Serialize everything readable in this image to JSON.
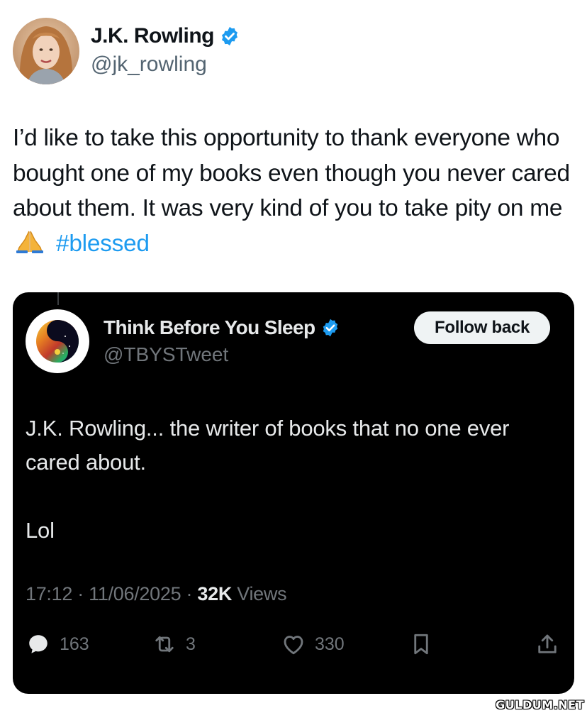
{
  "outer_tweet": {
    "author_name": "J.K. Rowling",
    "author_handle": "@jk_rowling",
    "text_main": "I’d like to take this opportunity to thank everyone who bought one of my books even though you never cared about them. It was very kind of you to take pity on me",
    "emoji_icon": "folded-hands-icon",
    "hashtag": "#blessed"
  },
  "quoted_tweet": {
    "author_name": "Think Before You Sleep",
    "author_handle": "@TBYSTweet",
    "follow_label": "Follow back",
    "text_line1": "J.K. Rowling... the writer of books that no one ever cared about.",
    "text_line2": "Lol",
    "timestamp": "17:12 · 11/06/2025 · ",
    "views_count": "32K",
    "views_label": " Views",
    "actions": {
      "reply_count": "163",
      "retweet_count": "3",
      "like_count": "330"
    }
  },
  "watermark": "GULDUM.NET",
  "colors": {
    "verified_badge": "#1d9bf0",
    "hashtag": "#1d9bf0",
    "card_background": "#000000",
    "secondary_text": "#71767b"
  }
}
